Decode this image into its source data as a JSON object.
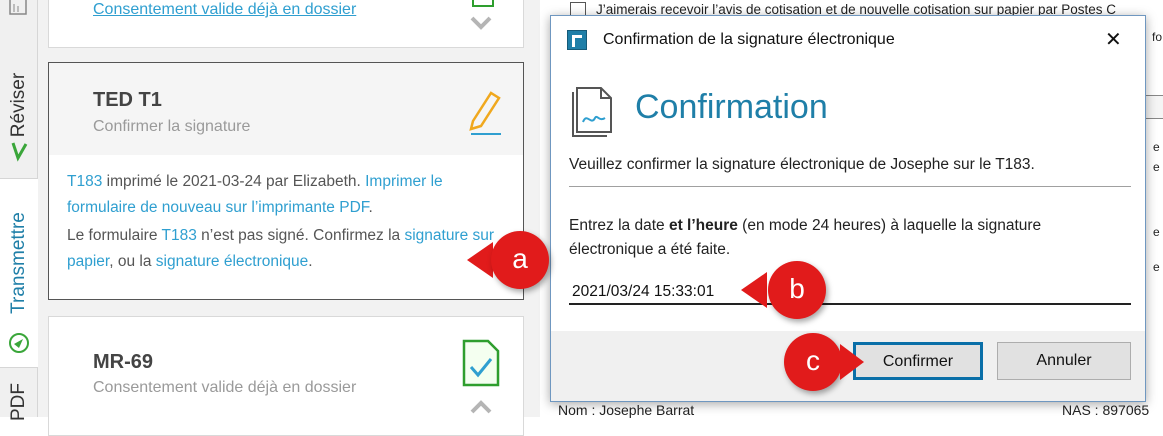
{
  "rail": {
    "tabs": [
      {
        "label": "Réviser"
      },
      {
        "label": "Transmettre"
      },
      {
        "label": "PDF"
      }
    ]
  },
  "cards": [
    {
      "sub_link": "Consentement valide déjà en dossier"
    },
    {
      "title": "TED T1",
      "subtitle": "Confirmer la signature",
      "msg1": {
        "form": "T183",
        "text_a": " imprimé le 2021-03-24 par Elizabeth. ",
        "link": "Imprimer le formulaire de nouveau sur l’imprimante PDF",
        "text_b": "."
      },
      "msg2": {
        "text_a": "Le formulaire ",
        "form": "T183",
        "text_b": " n’est pas signé. Confirmez la ",
        "link1": "signature sur papier",
        "text_c": ", ou la ",
        "link2": "signature électronique",
        "text_d": "."
      }
    },
    {
      "title": "MR-69",
      "subtitle": "Consentement valide déjà en dossier"
    }
  ],
  "background_form": {
    "checkbox_text": "J’aimerais recevoir l’avis de cotisation et de nouvelle cotisation sur papier par Postes C",
    "name_label": "Nom : Josephe Barrat",
    "nas_label": "NAS : 897065",
    "side_fragments": [
      "fo",
      "e",
      "e",
      "e",
      "e"
    ]
  },
  "dialog": {
    "title": "Confirmation de la signature électronique",
    "close": "✕",
    "heading": "Confirmation",
    "intro": "Veuillez confirmer la signature électronique de Josephe sur le T183.",
    "instr_a": "Entrez la date ",
    "instr_bold": "et l’heure",
    "instr_b": " (en mode 24 heures) à laquelle la signature électronique a été faite.",
    "datetime_value": "2021/03/24 15:33:01",
    "confirm_label": "Confirmer",
    "cancel_label": "Annuler"
  },
  "callouts": {
    "a": "a",
    "b": "b",
    "c": "c"
  },
  "colors": {
    "accent": "#1f7fa8",
    "link": "#2f9fd0",
    "callout": "#e11b1b",
    "pencil": "#f0a81e",
    "check_green": "#2e9e2e"
  }
}
